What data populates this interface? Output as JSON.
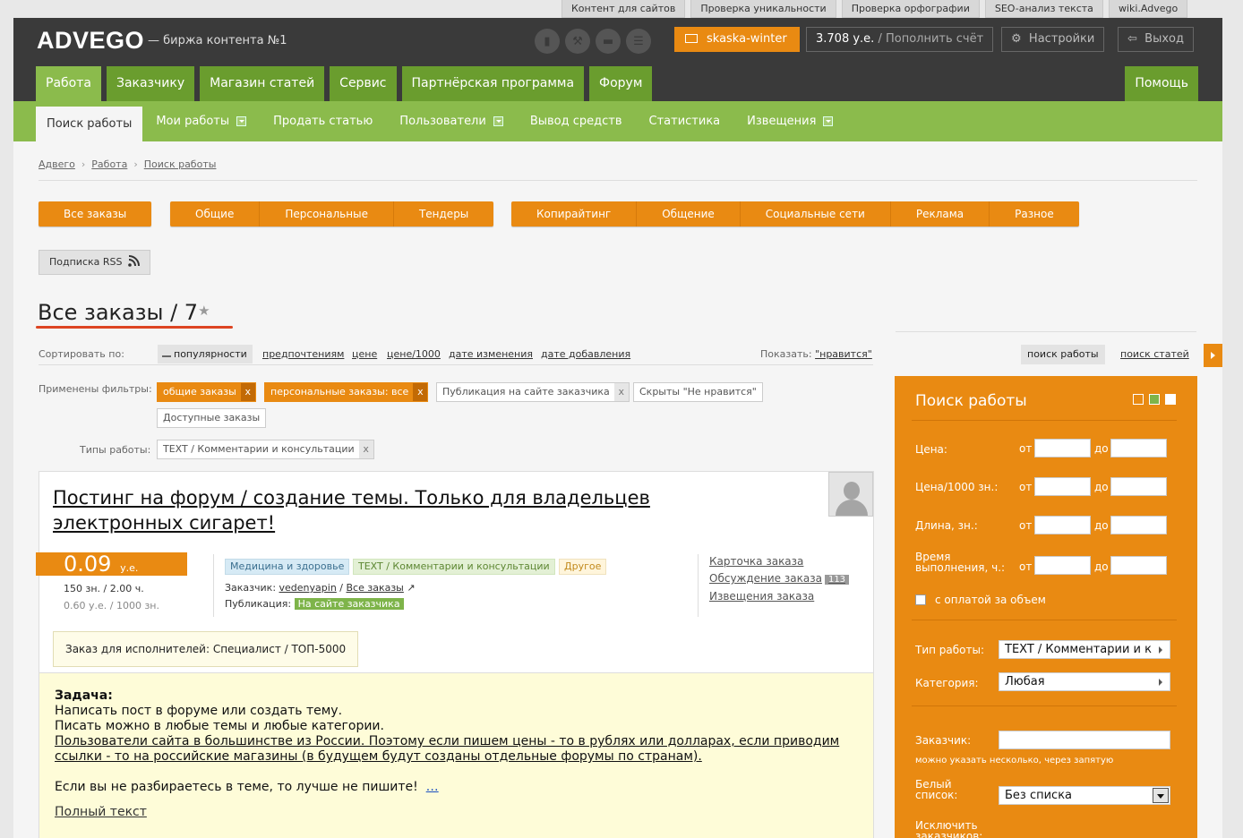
{
  "toplinks": [
    "Контент для сайтов",
    "Проверка уникальности",
    "Проверка орфографии",
    "SEO-анализ текста",
    "wiki.Advego"
  ],
  "header": {
    "logo": "ADVEGO",
    "slogan": "—  биржа контента №1",
    "user": "skaska-winter",
    "balance": "3.708 у.е.",
    "topup": "/ Пополнить счёт",
    "settings": "Настройки",
    "logout": "Выход",
    "help": "Помощь"
  },
  "main_tabs": [
    "Работа",
    "Заказчику",
    "Магазин статей",
    "Сервис",
    "Партнёрская программа",
    "Форум"
  ],
  "sub_tabs": [
    "Поиск работы",
    "Мои работы",
    "Продать статью",
    "Пользователи",
    "Вывод средств",
    "Статистика",
    "Извещения"
  ],
  "breadcrumb": [
    "Адвего",
    "Работа",
    "Поиск работы"
  ],
  "order_groups": {
    "all": "Все заказы",
    "types": [
      "Общие",
      "Персональные",
      "Тендеры"
    ],
    "categories": [
      "Копирайтинг",
      "Общение",
      "Социальные сети",
      "Реклама",
      "Разное"
    ]
  },
  "rss": "Подписка RSS",
  "page_title": "Все заказы / 7",
  "sort": {
    "label": "Сортировать по:",
    "current": "популярности",
    "options": [
      "предпочтениям",
      "цене",
      "цене/1000",
      "дате изменения",
      "дате добавления"
    ],
    "show_label": "Показать:",
    "show_value": "\"нравится\""
  },
  "filters": {
    "label": "Применены фильтры:",
    "chips": [
      "общие заказы",
      "персональные заказы: все",
      "Публикация на сайте заказчика",
      "Скрыты \"Не нравится\"",
      "Доступные заказы"
    ],
    "types_label": "Типы работы:",
    "types_chip": "TEXT / Комментарии и консультации",
    "close": "x"
  },
  "job": {
    "title": "Постинг на форум / создание темы. Только для владельцев электронных сигарет!",
    "price": "0.09",
    "currency": "у.е.",
    "meta1": "150 зн.  /  2.00 ч.",
    "meta2": "0.60 у.е.  /  1000 зн.",
    "tags": [
      "Медицина и здоровье",
      "TEXT / Комментарии и консультации",
      "Другое"
    ],
    "customer_label": "Заказчик:",
    "customer": "vedenyapin",
    "all_orders": "Все заказы",
    "pub_label": "Публикация:",
    "pub_value": "На сайте заказчика",
    "links": [
      "Карточка заказа",
      "Обсуждение заказа",
      "Извещения заказа"
    ],
    "discussion_count": "113",
    "for_exec": "Заказ для исполнителей: Специалист / ТОП-5000",
    "task_label": "Задача:",
    "task_lines": [
      "Написать пост в форуме или создать тему.",
      "Писать можно в любые темы и любые категории."
    ],
    "task_underlined": "Пользователи сайта в большинстве из России. Поэтому если пишем цены - то в рублях или долларах, если приводим ссылки - то на российские магазины (в будущем будут созданы отдельные форумы по странам).",
    "task_last": "Если вы не разбираетесь в теме, то лучше не пишите!",
    "more": "…",
    "full_text": "Полный текст"
  },
  "right": {
    "btn_search_work": "поиск работы",
    "btn_search_articles": "поиск статей",
    "panel_title": "Поиск работы",
    "price": "Цена:",
    "price1000": "Цена/1000 зн.:",
    "length": "Длина, зн.:",
    "time": "Время выполнения, ч.:",
    "from": "от",
    "to": "до",
    "volume_pay": "с оплатой за объем",
    "work_type_label": "Тип работы:",
    "work_type_value": "TEXT / Комментарии и к",
    "category_label": "Категория:",
    "category_value": "Любая",
    "customer_label": "Заказчик:",
    "customer_hint": "можно указать несколько, через запятую",
    "whitelist_label": "Белый список:",
    "whitelist_value": "Без списка",
    "exclude_label": "Исключить заказчиков:"
  }
}
